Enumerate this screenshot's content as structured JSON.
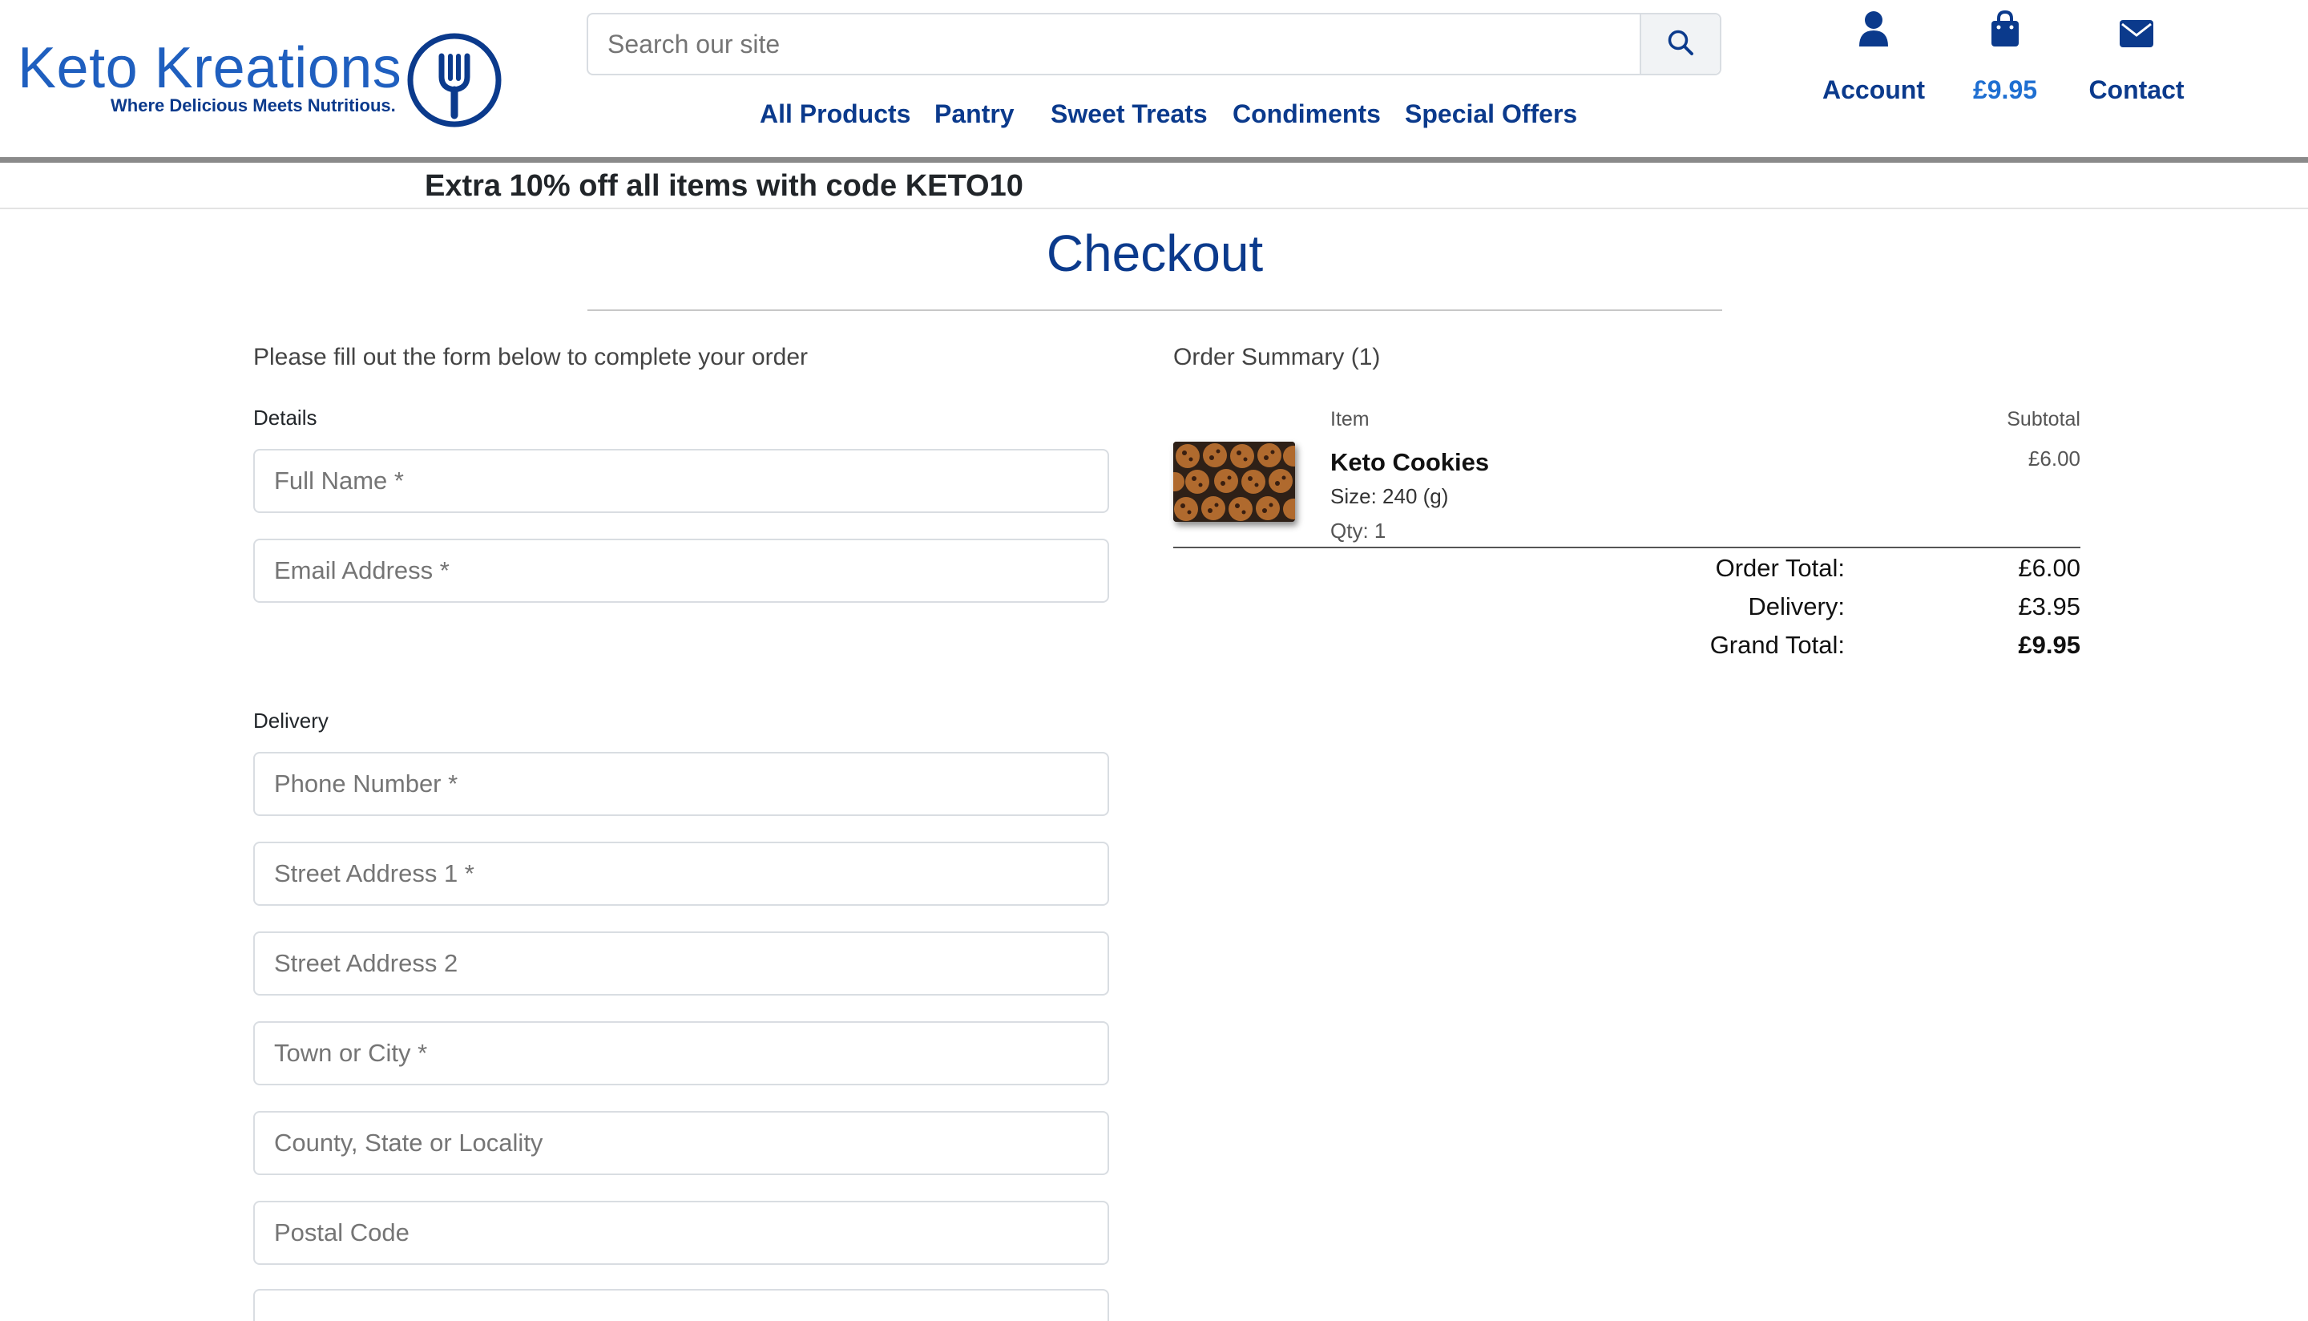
{
  "brand": {
    "name": "Keto Kreations",
    "tagline": "Where Delicious Meets Nutritious."
  },
  "search": {
    "placeholder": "Search our site"
  },
  "nav": {
    "items": [
      {
        "label": "All Products"
      },
      {
        "label": "Pantry"
      },
      {
        "label": "Sweet Treats"
      },
      {
        "label": "Condiments"
      },
      {
        "label": "Special Offers"
      }
    ]
  },
  "utility": {
    "account_label": "Account",
    "basket_total": "£9.95",
    "contact_label": "Contact"
  },
  "promo": {
    "text": "Extra 10% off all items with code KETO10"
  },
  "page": {
    "title": "Checkout"
  },
  "form": {
    "intro": "Please fill out the form below to complete your order",
    "details_label": "Details",
    "delivery_label": "Delivery",
    "fields": {
      "full_name": "Full Name *",
      "email": "Email Address *",
      "phone": "Phone Number *",
      "street1": "Street Address 1 *",
      "street2": "Street Address 2",
      "town": "Town or City *",
      "county": "County, State or Locality",
      "postcode": "Postal Code"
    }
  },
  "summary": {
    "heading": "Order Summary (1)",
    "col_item": "Item",
    "col_subtotal": "Subtotal",
    "items": [
      {
        "name": "Keto Cookies",
        "size": "Size: 240 (g)",
        "qty": "Qty: 1",
        "subtotal": "£6.00"
      }
    ],
    "order_total_label": "Order Total:",
    "order_total": "£6.00",
    "delivery_label": "Delivery:",
    "delivery": "£3.95",
    "grand_total_label": "Grand Total:",
    "grand_total": "£9.95"
  },
  "colors": {
    "brand_blue": "#1f5fbf",
    "nav_navy": "#0b3a8c",
    "basket_blue": "#1f6fd1"
  },
  "icons": [
    "fork-logo-icon",
    "search-icon",
    "user-icon",
    "shopping-bag-icon",
    "envelope-icon"
  ]
}
